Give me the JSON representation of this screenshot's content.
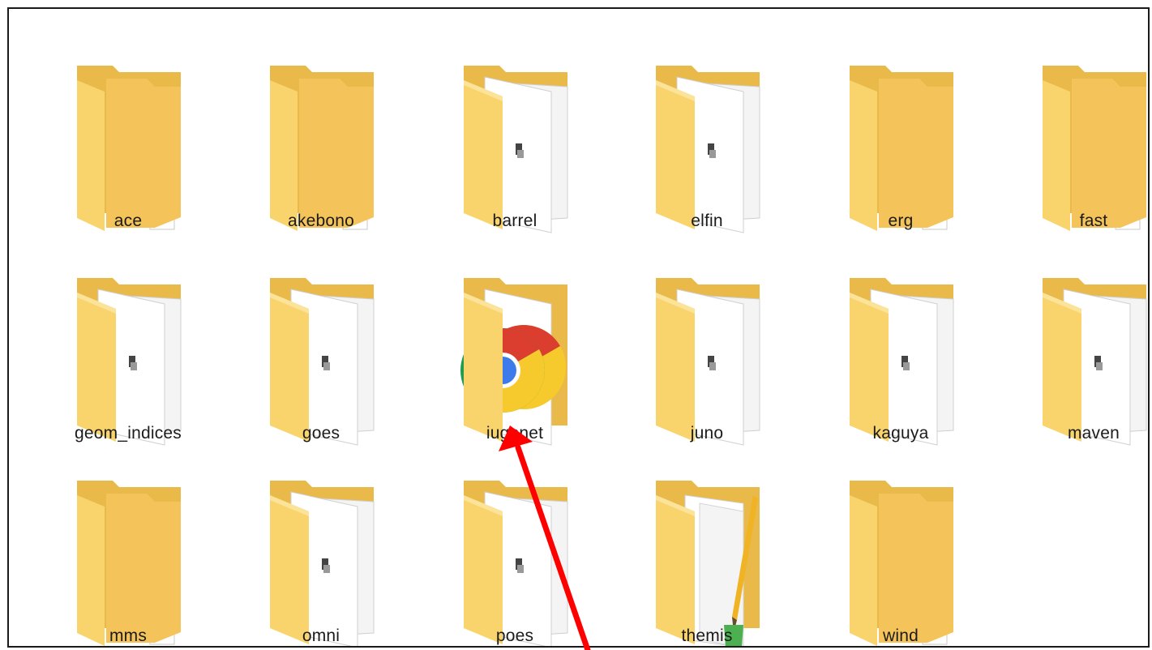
{
  "explorer": {
    "folders": [
      {
        "name": "ace",
        "icon": "folder-docs-icon"
      },
      {
        "name": "akebono",
        "icon": "folder-docs-icon"
      },
      {
        "name": "barrel",
        "icon": "folder-file-icon"
      },
      {
        "name": "elfin",
        "icon": "folder-file-icon"
      },
      {
        "name": "erg",
        "icon": "folder-docs-icon"
      },
      {
        "name": "fast",
        "icon": "folder-docs-icon"
      },
      {
        "name": "geom_indices",
        "icon": "folder-file-icon"
      },
      {
        "name": "goes",
        "icon": "folder-file-icon"
      },
      {
        "name": "iugonet",
        "icon": "folder-chrome-icon"
      },
      {
        "name": "juno",
        "icon": "folder-file-icon"
      },
      {
        "name": "kaguya",
        "icon": "folder-file-icon"
      },
      {
        "name": "maven",
        "icon": "folder-file-icon"
      },
      {
        "name": "mms",
        "icon": "folder-docs-icon"
      },
      {
        "name": "omni",
        "icon": "folder-file-icon"
      },
      {
        "name": "poes",
        "icon": "folder-file-icon"
      },
      {
        "name": "themis",
        "icon": "folder-pencil-icon"
      },
      {
        "name": "wind",
        "icon": "folder-docs-icon"
      }
    ]
  },
  "annotation": {
    "arrow_color": "#ff0000",
    "icon": "red-arrow-icon"
  },
  "colors": {
    "folder_front": "#f8d775",
    "folder_back": "#e8b84a",
    "border": "#1a1a1a"
  }
}
